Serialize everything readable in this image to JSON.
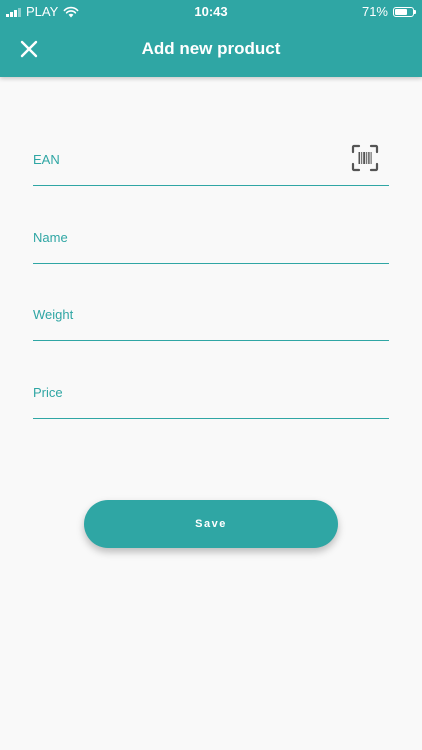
{
  "status_bar": {
    "carrier": "PLAY",
    "time": "10:43",
    "battery_percent": "71%",
    "battery_level": 0.71,
    "icons": [
      "signal-icon",
      "wifi-icon",
      "battery-icon"
    ]
  },
  "header": {
    "title": "Add new product",
    "close_icon": "close-icon"
  },
  "form": {
    "fields": [
      {
        "label": "EAN",
        "value": "",
        "icon": "barcode-scan-icon"
      },
      {
        "label": "Name",
        "value": ""
      },
      {
        "label": "Weight",
        "value": ""
      },
      {
        "label": "Price",
        "value": ""
      }
    ],
    "save_label": "Save"
  },
  "colors": {
    "accent": "#2fa6a4",
    "background": "#f9f9f9",
    "icon_gray": "#555555"
  }
}
